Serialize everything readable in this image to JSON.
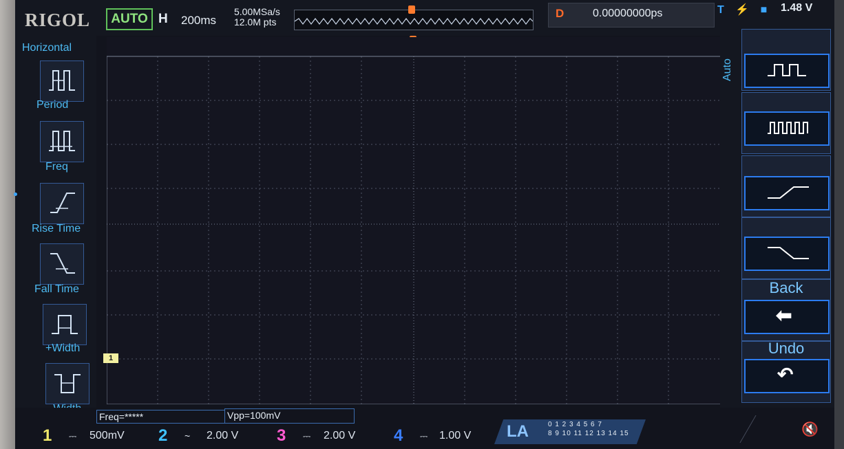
{
  "header": {
    "brand": "RIGOL",
    "run_mode": "AUTO",
    "timebase_label": "H",
    "timebase_value": "200ms",
    "sample_rate": "5.00MSa/s",
    "memory_depth": "12.0M pts",
    "delay_label": "D",
    "delay_value": "0.00000000ps",
    "trigger_icons": "T ⚡ ■",
    "trigger_level": "1.48 V"
  },
  "left_menu": {
    "title": "Horizontal",
    "items": [
      {
        "label": "Period",
        "icon": "period-icon"
      },
      {
        "label": "Freq",
        "icon": "freq-icon"
      },
      {
        "label": "Rise Time",
        "icon": "rise-time-icon"
      },
      {
        "label": "Fall Time",
        "icon": "fall-time-icon"
      },
      {
        "label": "+Width",
        "icon": "positive-width-icon"
      },
      {
        "label": "-Width",
        "icon": "negative-width-icon"
      }
    ]
  },
  "right_menu": {
    "auto_label": "Auto",
    "back_label": "Back",
    "undo_label": "Undo",
    "items": [
      {
        "icon": "single-pulse-icon"
      },
      {
        "icon": "pulse-train-icon"
      },
      {
        "icon": "rising-edge-icon"
      },
      {
        "icon": "falling-edge-icon"
      }
    ]
  },
  "markers": {
    "ch1": "1",
    "trigger": "T"
  },
  "measurements": [
    {
      "text": "Freq=*****"
    },
    {
      "text": "Vpp=100mV"
    }
  ],
  "channels": [
    {
      "number": "1",
      "coupling": "⎓",
      "scale": "500mV",
      "color": "#f0e86a"
    },
    {
      "number": "2",
      "coupling": "~",
      "scale": "2.00 V",
      "color": "#3fc2ff"
    },
    {
      "number": "3",
      "coupling": "⎓",
      "scale": "2.00 V",
      "color": "#ff5ad0"
    },
    {
      "number": "4",
      "coupling": "⎓",
      "scale": "1.00 V",
      "color": "#3a7dff"
    }
  ],
  "la": {
    "label": "LA",
    "row1": "0 1 2 3  4 5 6 7",
    "row2": "8 9 10 11  12 13 14 15"
  },
  "speaker_icon": "speaker-mute-icon"
}
